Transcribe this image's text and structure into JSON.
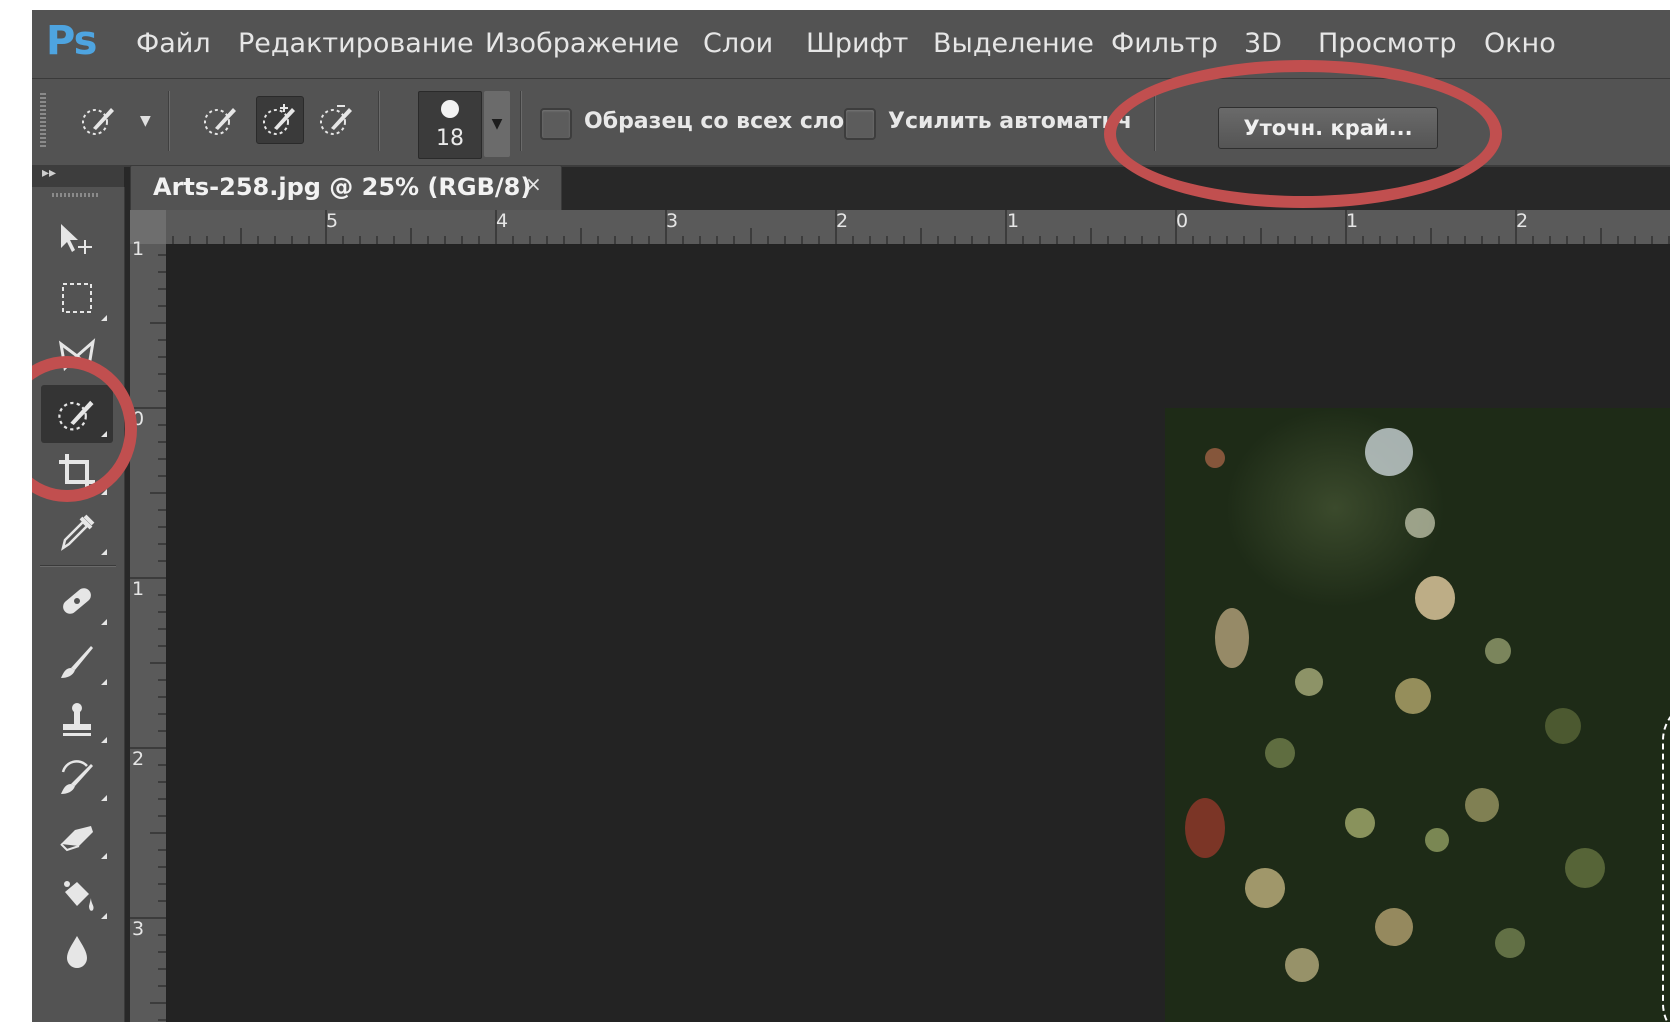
{
  "app": {
    "logo": "Ps"
  },
  "menu": [
    "Файл",
    "Редактирование",
    "Изображение",
    "Слои",
    "Шрифт",
    "Выделение",
    "Фильтр",
    "3D",
    "Просмотр",
    "Окно"
  ],
  "options": {
    "brush_size": "18",
    "sample_all_layers_label": "Образец со всех слоев",
    "auto_enhance_label": "Усилить автоматически",
    "refine_edge_label": "Уточн. край..."
  },
  "document": {
    "tab_title": "Arts-258.jpg @ 25% (RGB/8)",
    "close_glyph": "×"
  },
  "rulers": {
    "horizontal": [
      "5",
      "4",
      "3",
      "2",
      "1",
      "0",
      "1",
      "2"
    ],
    "vertical": [
      "1",
      "0",
      "1",
      "2",
      "3"
    ]
  },
  "toolbar_icons": [
    "move-tool-icon",
    "marquee-tool-icon",
    "lasso-tool-icon",
    "quick-selection-tool-icon",
    "crop-tool-icon",
    "eyedropper-tool-icon",
    "healing-brush-tool-icon",
    "brush-tool-icon",
    "clone-stamp-tool-icon",
    "history-brush-tool-icon",
    "eraser-tool-icon",
    "paint-bucket-tool-icon",
    "blur-tool-icon"
  ],
  "colors": {
    "annotation": "#c14f4f",
    "logo": "#4ea4e0",
    "panel": "#535353",
    "canvas": "#232323"
  }
}
